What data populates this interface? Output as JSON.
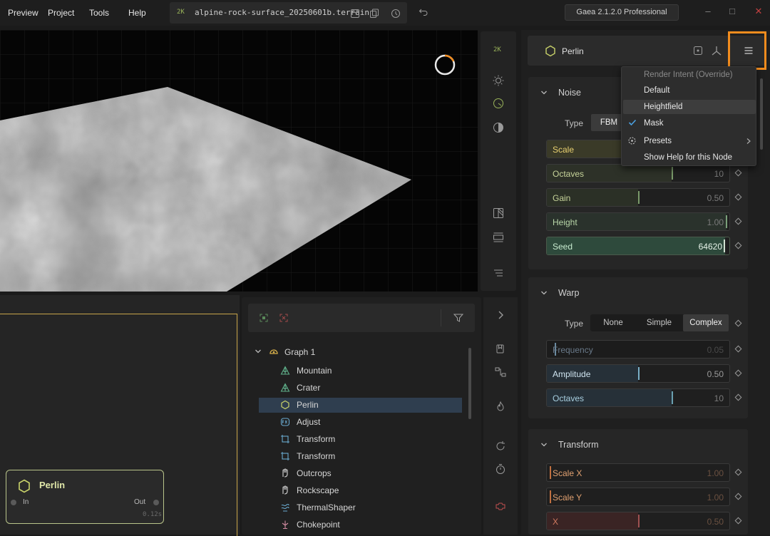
{
  "menubar": {
    "items": [
      "Preview",
      "Project",
      "Tools",
      "Help"
    ]
  },
  "file": {
    "badge": "2K",
    "name": "alpine-rock-surface_20250601b.terrain"
  },
  "version": "Gaea 2.1.2.0 Professional",
  "viewport_toolbar": {
    "badge": "2K"
  },
  "properties": {
    "node_name": "Perlin",
    "noise": {
      "title": "Noise",
      "type_label": "Type",
      "type_value": "FBM",
      "scale_label": "Scale",
      "octaves": {
        "label": "Octaves",
        "value": "10"
      },
      "gain": {
        "label": "Gain",
        "value": "0.50"
      },
      "height": {
        "label": "Height",
        "value": "1.00"
      },
      "seed": {
        "label": "Seed",
        "value": "64620"
      }
    },
    "warp": {
      "title": "Warp",
      "type_label": "Type",
      "types": [
        "None",
        "Simple",
        "Complex"
      ],
      "selected": "Complex",
      "frequency": {
        "label": "Frequency",
        "value": "0.05"
      },
      "amplitude": {
        "label": "Amplitude",
        "value": "0.50"
      },
      "octaves": {
        "label": "Octaves",
        "value": "10"
      }
    },
    "transform": {
      "title": "Transform",
      "scale_x": {
        "label": "Scale X",
        "value": "1.00"
      },
      "scale_y": {
        "label": "Scale Y",
        "value": "1.00"
      },
      "x": {
        "label": "X",
        "value": "0.50"
      }
    }
  },
  "dropdown": {
    "header": "Render Intent (Override)",
    "items": [
      "Default",
      "Heightfield",
      "Mask"
    ],
    "checked": "Mask",
    "highlighted": "Heightfield",
    "presets": "Presets",
    "help": "Show Help for this Node"
  },
  "explorer": {
    "root": "Graph 1",
    "items": [
      {
        "label": "Mountain",
        "icon": "mountain-icon"
      },
      {
        "label": "Crater",
        "icon": "crater-icon"
      },
      {
        "label": "Perlin",
        "icon": "perlin-hex-icon"
      },
      {
        "label": "Adjust",
        "icon": "fx-icon"
      },
      {
        "label": "Transform",
        "icon": "transform-icon"
      },
      {
        "label": "Transform",
        "icon": "transform-icon"
      },
      {
        "label": "Outcrops",
        "icon": "hand-icon"
      },
      {
        "label": "Rockscape",
        "icon": "hand-icon"
      },
      {
        "label": "ThermalShaper",
        "icon": "thermal-icon"
      },
      {
        "label": "Chokepoint",
        "icon": "chokepoint-icon"
      }
    ],
    "selected_index": 2
  },
  "graph_node": {
    "title": "Perlin",
    "in": "In",
    "out": "Out",
    "time": "0.12s"
  },
  "colors": {
    "accent": "#f28c1e",
    "node_border": "#b9c48a",
    "selection": "#2f3e4f"
  }
}
